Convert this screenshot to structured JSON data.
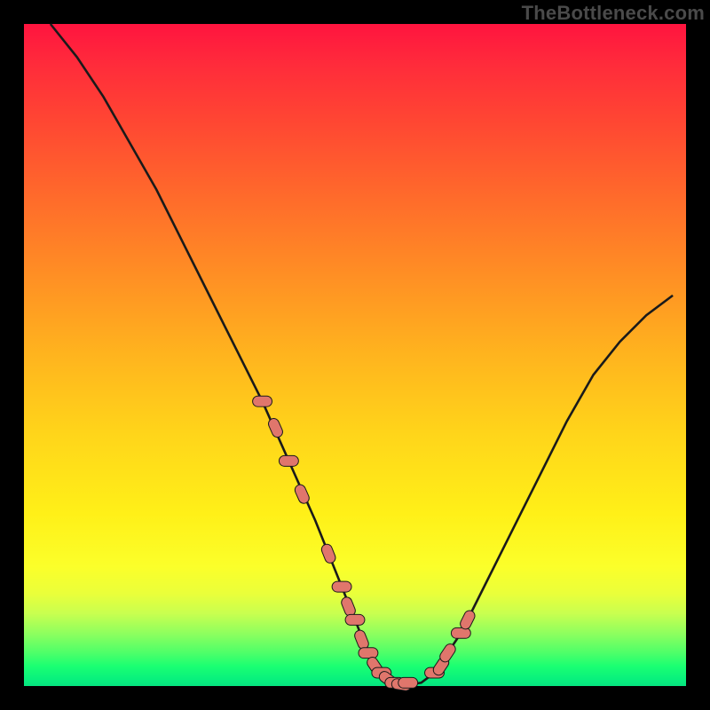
{
  "watermark": "TheBottleneck.com",
  "colors": {
    "frame_bg": "#000000",
    "curve_stroke": "#1a1a1a",
    "marker_fill": "#e0766c",
    "marker_edge": "#1a1a1a"
  },
  "chart_data": {
    "type": "line",
    "title": "",
    "xlabel": "",
    "ylabel": "",
    "xlim": [
      0,
      100
    ],
    "ylim": [
      0,
      100
    ],
    "grid": false,
    "background_gradient": [
      "#ff143f",
      "#ffb41e",
      "#fff018",
      "#06e37f"
    ],
    "series": [
      {
        "name": "bottleneck-curve",
        "x": [
          4,
          8,
          12,
          16,
          20,
          24,
          28,
          32,
          36,
          40,
          44,
          48,
          50,
          52,
          54,
          56,
          58,
          60,
          62,
          66,
          70,
          74,
          78,
          82,
          86,
          90,
          94,
          98
        ],
        "values": [
          100,
          95,
          89,
          82,
          75,
          67,
          59,
          51,
          43,
          34,
          25,
          15,
          10,
          5,
          2,
          0.5,
          0.2,
          0.5,
          2,
          8,
          16,
          24,
          32,
          40,
          47,
          52,
          56,
          59
        ]
      },
      {
        "name": "highlight-markers",
        "x": [
          36,
          38,
          40,
          42,
          46,
          48,
          49,
          50,
          51,
          52,
          53,
          54,
          55,
          56,
          57,
          58,
          62,
          63,
          64,
          66,
          67
        ],
        "values": [
          43,
          39,
          34,
          29,
          20,
          15,
          12,
          10,
          7,
          5,
          3,
          2,
          1,
          0.5,
          0.2,
          0.5,
          2,
          3,
          5,
          8,
          10
        ]
      }
    ]
  }
}
